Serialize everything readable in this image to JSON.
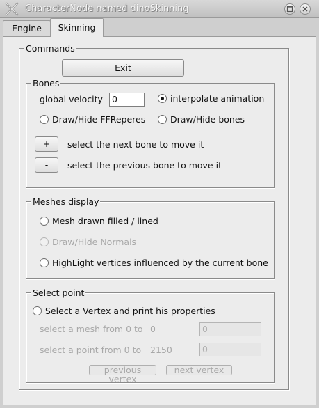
{
  "window": {
    "title": "CharacterNode named dinoSkinning"
  },
  "tabs": [
    {
      "label": "Engine"
    },
    {
      "label": "Skinning"
    }
  ],
  "commands": {
    "legend": "Commands",
    "exit_label": "Exit"
  },
  "bones": {
    "legend": "Bones",
    "velocity_label": "global velocity",
    "velocity_value": "0",
    "interpolate_label": "interpolate animation",
    "ffrep_label": "Draw/Hide FFReperes",
    "bones_label": "Draw/Hide bones",
    "plus_label": "+",
    "plus_desc": "select the next bone to move it",
    "minus_label": "-",
    "minus_desc": "select the previous bone to move it"
  },
  "meshes": {
    "legend": "Meshes display",
    "filled_label": "Mesh drawn filled / lined",
    "normals_label": "Draw/Hide Normals",
    "highlight_label": "HighLight vertices influenced by the current bone"
  },
  "select_point": {
    "legend": "Select point",
    "vertex_label": "Select a Vertex and print his properties",
    "mesh_range_label": "select a mesh from 0 to",
    "mesh_max": "0",
    "mesh_value": "0",
    "point_range_label": "select a point from 0 to",
    "point_max": "2150",
    "point_value": "0",
    "prev_label": "previous vertex",
    "next_label": "next vertex"
  }
}
